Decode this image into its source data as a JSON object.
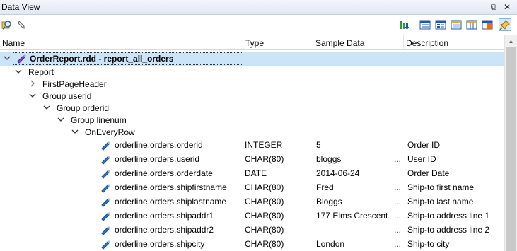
{
  "window": {
    "title": "Data View",
    "restore_glyph": "⧉",
    "close_glyph": "✕"
  },
  "columns": {
    "name": "Name",
    "type": "Type",
    "sample": "Sample Data",
    "description": "Description"
  },
  "tree": {
    "root": "OrderReport.rdd - report_all_orders",
    "report": "Report",
    "first_page_header": "FirstPageHeader",
    "group_userid": "Group userid",
    "group_orderid": "Group orderid",
    "group_linenum": "Group linenum",
    "on_every_row": "OnEveryRow"
  },
  "fields": [
    {
      "name": "orderline.orders.orderid",
      "type": "INTEGER",
      "sample": "5",
      "ellipsis": "",
      "description": "Order ID"
    },
    {
      "name": "orderline.orders.userid",
      "type": "CHAR(80)",
      "sample": "bloggs",
      "ellipsis": "...",
      "description": "User ID"
    },
    {
      "name": "orderline.orders.orderdate",
      "type": "DATE",
      "sample": "2014-06-24",
      "ellipsis": "",
      "description": "Order Date"
    },
    {
      "name": "orderline.orders.shipfirstname",
      "type": "CHAR(80)",
      "sample": "Fred",
      "ellipsis": "...",
      "description": "Ship-to first name"
    },
    {
      "name": "orderline.orders.shiplastname",
      "type": "CHAR(80)",
      "sample": "Bloggs",
      "ellipsis": "...",
      "description": "Ship-to last name"
    },
    {
      "name": "orderline.orders.shipaddr1",
      "type": "CHAR(80)",
      "sample": "177 Elms Crescent",
      "ellipsis": "...",
      "description": "Ship-to address line 1"
    },
    {
      "name": "orderline.orders.shipaddr2",
      "type": "CHAR(80)",
      "sample": "",
      "ellipsis": "...",
      "description": "Ship-to address line 2"
    },
    {
      "name": "orderline.orders.shipcity",
      "type": "CHAR(80)",
      "sample": "London",
      "ellipsis": "...",
      "description": "Ship-to city"
    }
  ],
  "colors": {
    "selection": "#cce4f7",
    "accent": "#0b5cad",
    "field_icon": "#2d78c9",
    "root_icon": "#7b4fc7"
  }
}
